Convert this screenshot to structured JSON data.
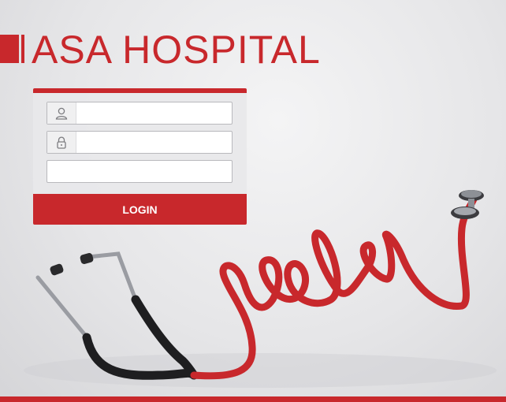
{
  "brand": {
    "title": "ASA HOSPITAL",
    "accent_color": "#c8282c"
  },
  "login_form": {
    "username_field": {
      "value": "",
      "placeholder": "",
      "icon": "user-icon"
    },
    "password_field": {
      "value": "",
      "placeholder": "",
      "icon": "lock-icon"
    },
    "extra_field": {
      "value": "",
      "placeholder": ""
    },
    "login_button_label": "LOGIN"
  },
  "background": {
    "illustration": "stethoscope-help-icon"
  }
}
